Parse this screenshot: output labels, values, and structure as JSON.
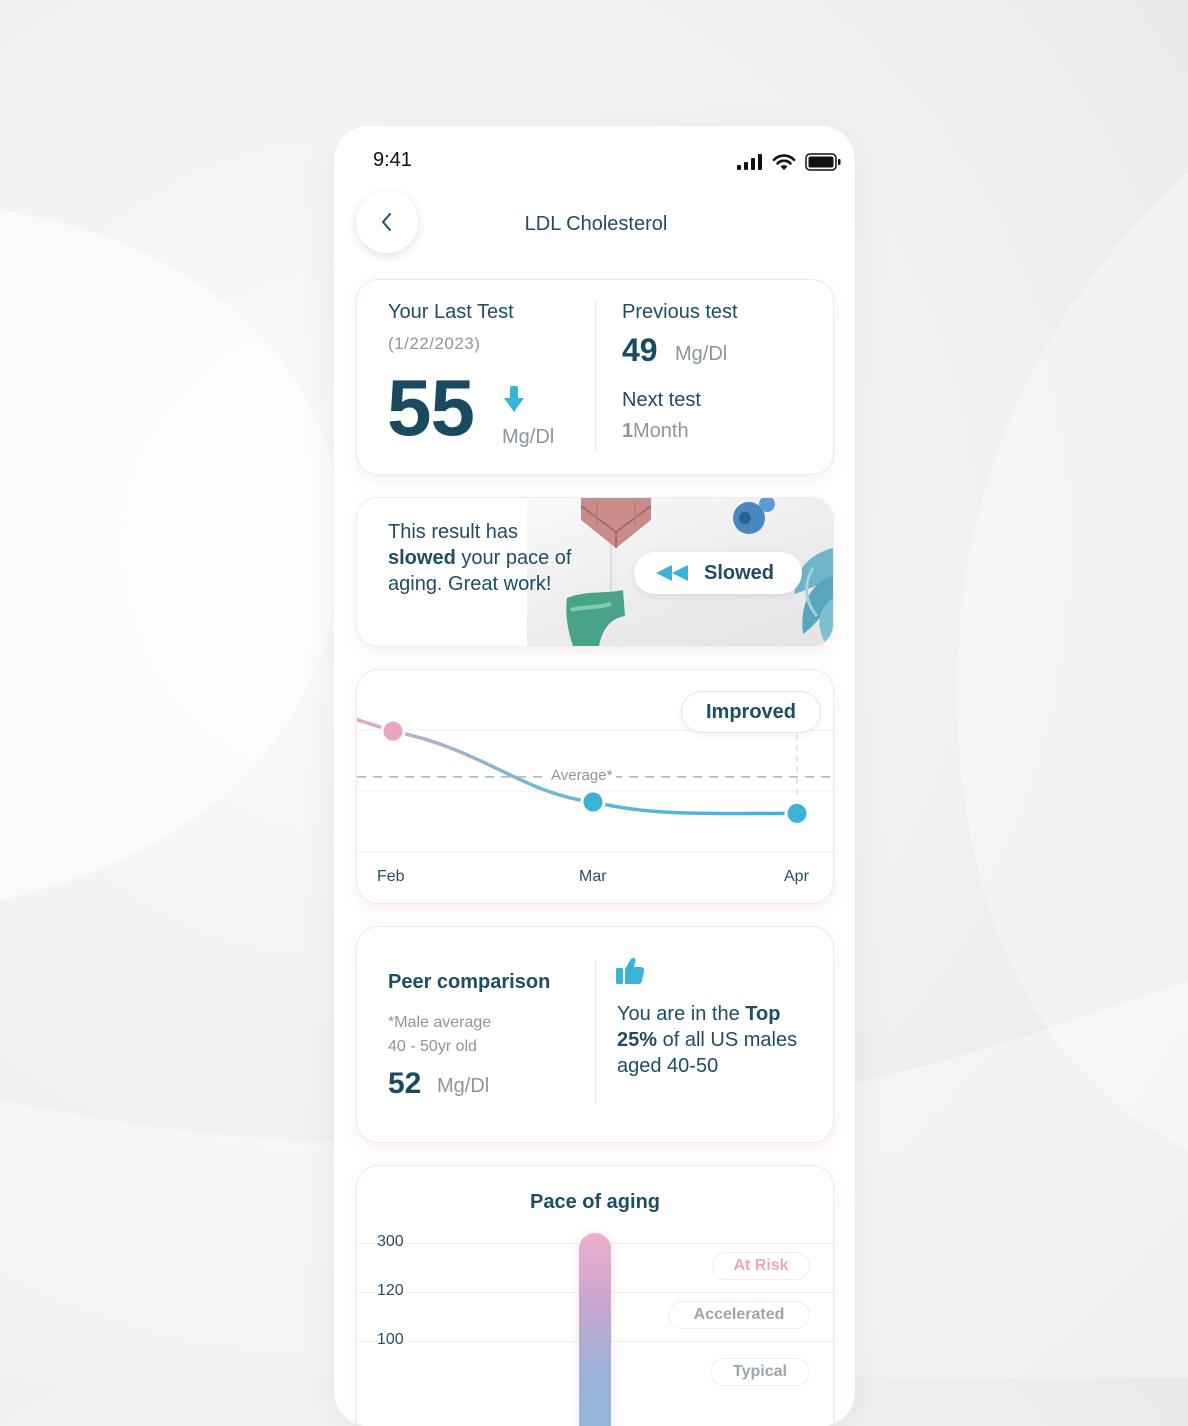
{
  "status_bar": {
    "time": "9:41"
  },
  "header": {
    "title": "LDL Cholesterol"
  },
  "last_test": {
    "label": "Your Last Test",
    "date": "(1/22/2023)",
    "value": "55",
    "unit": "Mg/Dl"
  },
  "previous_test": {
    "label": "Previous test",
    "value": "49",
    "unit": "Mg/Dl"
  },
  "next_test": {
    "label": "Next test",
    "value": "1",
    "unit": "Month"
  },
  "aging_banner": {
    "text_prefix": "This result has ",
    "text_bold": "slowed",
    "text_suffix": " your pace of aging. Great work!",
    "badge_label": "Slowed"
  },
  "trend_chart": {
    "badge": "Improved",
    "average_label": "Average*"
  },
  "chart_data": {
    "type": "line",
    "x": [
      "Feb",
      "Mar",
      "Apr"
    ],
    "series": [
      {
        "values": [
          82,
          51,
          46
        ]
      }
    ],
    "average_line": 62,
    "ylim": [
      30,
      100
    ],
    "grid": true
  },
  "peer_comparison": {
    "title": "Peer comparison",
    "note_line1": "*Male average",
    "note_line2": "40 - 50yr old",
    "value": "52",
    "unit": "Mg/Dl",
    "message_prefix": "You are in the ",
    "message_bold": "Top 25%",
    "message_suffix": " of all US males aged 40-50"
  },
  "pace_of_aging": {
    "title": "Pace of aging",
    "y_ticks": [
      "300",
      "120",
      "100"
    ],
    "zones": [
      "At Risk",
      "Accelerated",
      "Typical"
    ],
    "colors": {
      "at_risk": "#f0a6c3",
      "accelerated": "#9aa6ad",
      "typical": "#9aa6ad"
    }
  },
  "colors": {
    "primary": "#1d4e63",
    "accent": "#3cb3d6",
    "muted": "#8a979e",
    "pink": "#e8a6c4"
  }
}
